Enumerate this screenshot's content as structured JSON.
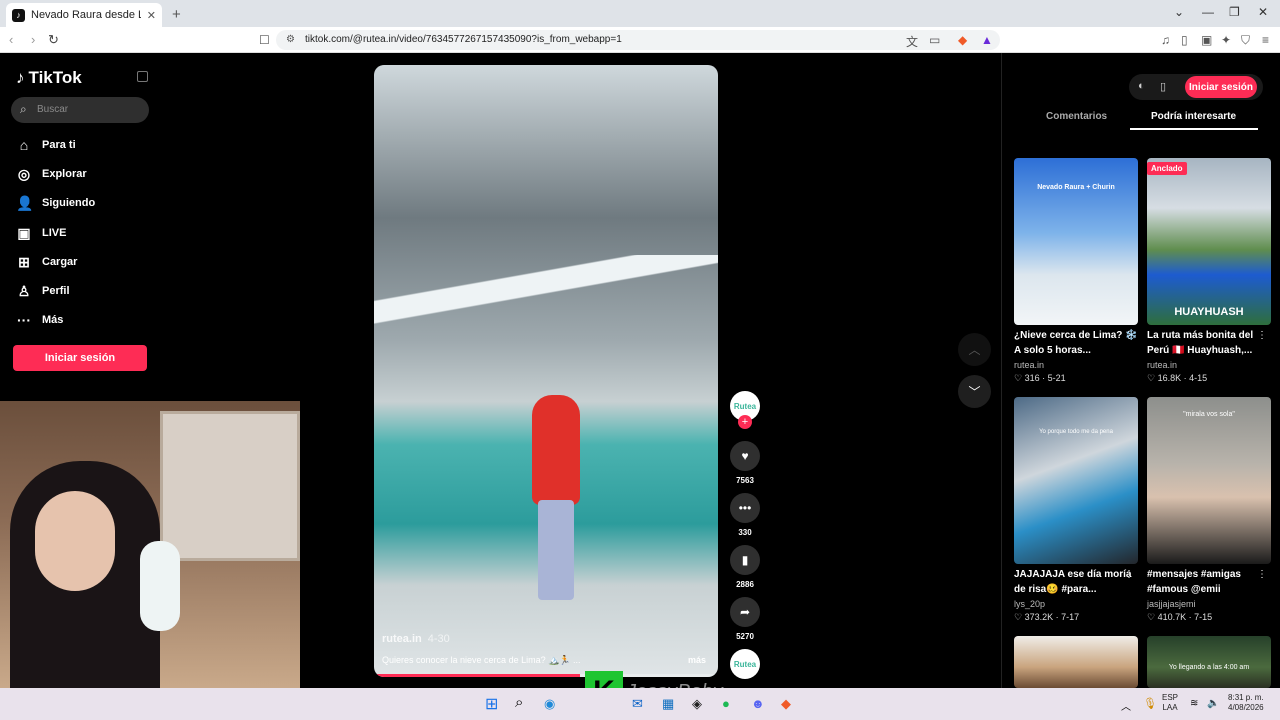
{
  "browser": {
    "tab_title": "Nevado Raura desde Lima: to",
    "tab_favicon": "tiktok-icon",
    "url": "tiktok.com/@rutea.in/video/7634577267157435090?is_from_webapp=1"
  },
  "sidebar": {
    "brand": "TikTok",
    "search_placeholder": "Buscar",
    "items": [
      {
        "label": "Para ti",
        "icon": "home-icon"
      },
      {
        "label": "Explorar",
        "icon": "compass-icon"
      },
      {
        "label": "Siguiendo",
        "icon": "following-icon"
      },
      {
        "label": "LIVE",
        "icon": "live-icon"
      },
      {
        "label": "Cargar",
        "icon": "upload-icon"
      },
      {
        "label": "Perfil",
        "icon": "profile-icon"
      },
      {
        "label": "Más",
        "icon": "more-icon"
      }
    ],
    "login_label": "Iniciar sesión"
  },
  "video": {
    "author": "rutea.in",
    "age": "4-30",
    "caption": "Quieres conocer la nieve cerca de Lima? 🏔️🏃 ...",
    "more_label": "más",
    "avatar_text": "Rutea",
    "progress": 0.6
  },
  "actions": [
    {
      "name": "like",
      "icon": "heart-icon",
      "count": "7563"
    },
    {
      "name": "comment",
      "icon": "comment-icon",
      "count": "330"
    },
    {
      "name": "save",
      "icon": "bookmark-icon",
      "count": "2886"
    },
    {
      "name": "share",
      "icon": "share-icon",
      "count": "5270"
    }
  ],
  "right_panel": {
    "login_label": "Iniciar sesión",
    "tabs": [
      "Comentarios",
      "Podría interesarte"
    ],
    "active_tab": "Podría interesarte",
    "cards": [
      {
        "title": "¿Nieve cerca de Lima? ❄️ A solo 5 horas...",
        "author": "rutea.in",
        "likes": "316",
        "date": "5-21",
        "overlay": "Nevado Raura + Churin",
        "pinned": ""
      },
      {
        "title": "La ruta más bonita del Perú 🇵🇪 Huayhuash,...",
        "author": "rutea.in",
        "likes": "16.8K",
        "date": "4-15",
        "overlay": "HUAYHUASH",
        "pinned": "Anclado"
      },
      {
        "title": "JAJAJAJA ese día moría de risa🥴 #para...",
        "author": "lys_20p",
        "likes": "373.2K",
        "date": "7-17",
        "overlay": "Yo porque todo me da pena",
        "pinned": ""
      },
      {
        "title": "#mensajes #amigas #famous @emii",
        "author": "jasjjajasjemi",
        "likes": "410.7K",
        "date": "7-15",
        "overlay": "\"mirala vos sola\"",
        "pinned": ""
      },
      {
        "title": "",
        "author": "",
        "likes": "",
        "date": "",
        "overlay": "",
        "pinned": ""
      },
      {
        "title": "",
        "author": "",
        "likes": "",
        "date": "",
        "overlay": "Yo llegando a las 4:00 am",
        "pinned": ""
      }
    ]
  },
  "stream_overlay": {
    "badge": "K",
    "name": "JessyBaby"
  },
  "taskbar": {
    "lang_top": "ESP",
    "lang_bottom": "LAA",
    "time": "8:31 p. m.",
    "date": "4/08/2026"
  }
}
